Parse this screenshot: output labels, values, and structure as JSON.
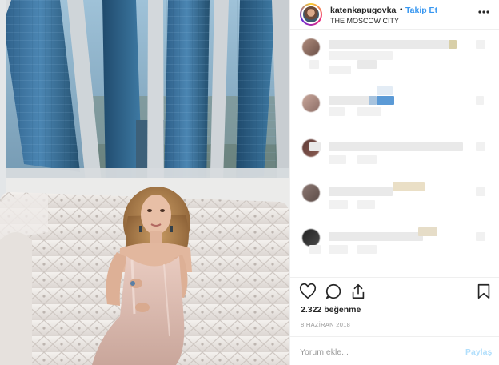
{
  "post": {
    "username": "katenkapugovka",
    "separator": "•",
    "follow_label": "Takip Et",
    "location": "THE MOSCOW CITY",
    "likes_text": "2.322 beğenme",
    "date_text": "8 HAZİRAN 2018"
  },
  "icons": {
    "more": "more-options-icon",
    "like": "heart-icon",
    "comment": "comment-icon",
    "share": "share-icon",
    "save": "bookmark-icon"
  },
  "comment_box": {
    "placeholder": "Yorum ekle...",
    "post_label": "Paylaş"
  },
  "colors": {
    "follow": "#3897f0",
    "post_disabled": "#b2dffc",
    "text": "#262626",
    "muted": "#999999"
  }
}
